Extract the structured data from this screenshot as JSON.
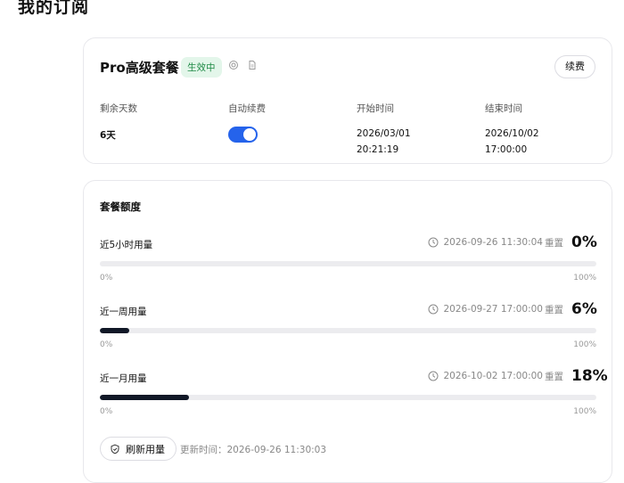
{
  "page": {
    "title": "我的订阅"
  },
  "plan": {
    "name": "Pro高级套餐",
    "status": "生效中",
    "renew_label": "续费",
    "remaining_label": "剩余天数",
    "remaining_value": "6天",
    "auto_renew_label": "自动续费",
    "auto_renew_on": true,
    "start_label": "开始时间",
    "start_date": "2026/03/01",
    "start_time": "20:21:19",
    "end_label": "结束时间",
    "end_date": "2026/10/02",
    "end_time": "17:00:00",
    "accent_color": "#2563eb",
    "status_color": "#1f8a46"
  },
  "quota": {
    "title": "套餐额度",
    "reset_word": "重置",
    "scale_min": "0%",
    "scale_max": "100%",
    "items": [
      {
        "label": "近5小时用量",
        "reset_time": "2026-09-26 11:30:04",
        "percent_text": "0%",
        "percent": 0
      },
      {
        "label": "近一周用量",
        "reset_time": "2026-09-27 17:00:00",
        "percent_text": "6%",
        "percent": 6
      },
      {
        "label": "近一月用量",
        "reset_time": "2026-10-02 17:00:00",
        "percent_text": "18%",
        "percent": 18
      }
    ],
    "refresh_label": "刷新用量",
    "updated_label": "更新时间：",
    "updated_time": "2026-09-26 11:30:03"
  }
}
